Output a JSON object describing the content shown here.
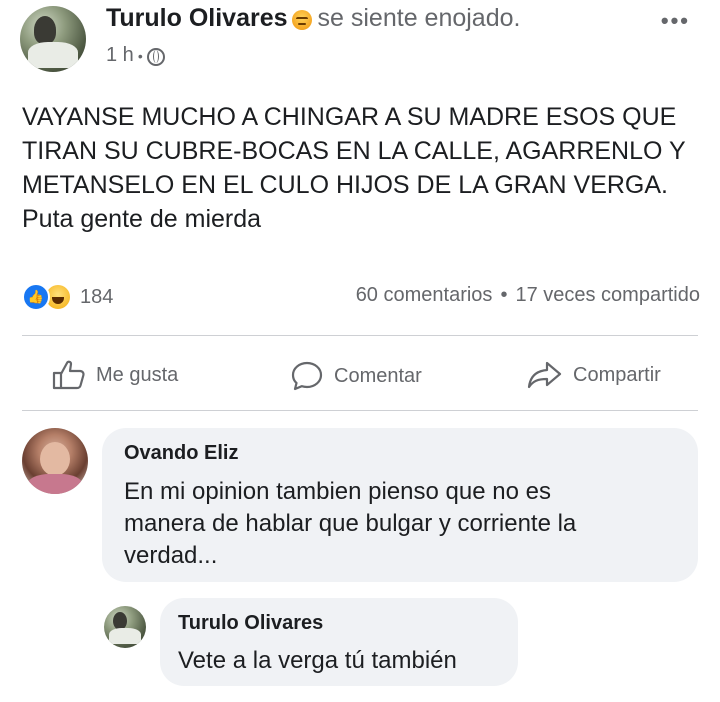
{
  "post": {
    "author": "Turulo Olivares",
    "feeling": "se siente enojado.",
    "feeling_icon": "angry-face-emoji",
    "time": "1 h",
    "privacy_icon": "globe-icon",
    "text_lines": [
      "VAYANSE MUCHO A CHINGAR A SU MADRE ESOS QUE",
      "TIRAN SU CUBRE-BOCAS EN LA CALLE, AGARRENLO Y",
      "METANSELO EN EL CULO HIJOS DE LA GRAN VERGA.",
      "Puta gente de mierda"
    ],
    "reaction_count": "184",
    "comments_count": "60 comentarios",
    "shares_count": "17 veces compartido"
  },
  "actions": {
    "like": "Me gusta",
    "comment": "Comentar",
    "share": "Compartir"
  },
  "comments": [
    {
      "author": "Ovando Eliz",
      "text_lines": [
        "En mi opinion tambien pienso que no es",
        "manera de hablar que bulgar y corriente la",
        "verdad..."
      ]
    },
    {
      "author": "Turulo Olivares",
      "text_lines": [
        "Vete a la verga tú también"
      ]
    }
  ],
  "colors": {
    "facebook_blue": "#1877f2",
    "secondary_text": "#65676b",
    "bubble_bg": "#f0f2f5"
  }
}
